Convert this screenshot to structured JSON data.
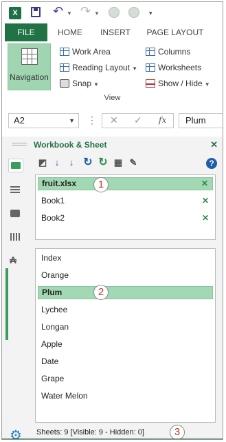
{
  "qat": {
    "app_icon": "excel-logo-icon",
    "app_letter": "X",
    "icons": [
      "save-icon",
      "undo-icon",
      "redo-icon",
      "circle-icon",
      "circle-icon",
      "customize-qat-icon"
    ]
  },
  "ribbon_tabs": [
    {
      "label": "FILE",
      "active_color": "#217346"
    },
    {
      "label": "HOME"
    },
    {
      "label": "INSERT"
    },
    {
      "label": "PAGE LAYOUT"
    }
  ],
  "ribbon": {
    "navigation_label": "Navigation",
    "work_area": "Work Area",
    "reading_layout": "Reading Layout",
    "snap": "Snap",
    "columns": "Columns",
    "worksheets": "Worksheets",
    "show_hide": "Show / Hide",
    "group_label": "View"
  },
  "formula_bar": {
    "name_box": "A2",
    "fx": "fx",
    "content": "Plum"
  },
  "pane": {
    "title": "Workbook & Sheet",
    "workbooks": [
      {
        "name": "fruit.xlsx",
        "selected": true
      },
      {
        "name": "Book1",
        "selected": false
      },
      {
        "name": "Book2",
        "selected": false
      }
    ],
    "sheets": [
      {
        "name": "Index",
        "selected": false
      },
      {
        "name": "Orange",
        "selected": false
      },
      {
        "name": "Plum",
        "selected": true
      },
      {
        "name": "Lychee",
        "selected": false
      },
      {
        "name": "Longan",
        "selected": false
      },
      {
        "name": "Apple",
        "selected": false
      },
      {
        "name": "Date",
        "selected": false
      },
      {
        "name": "Grape",
        "selected": false
      },
      {
        "name": "Water Melon",
        "selected": false
      }
    ],
    "status": "Sheets: 9  [Visible: 9 - Hidden: 0]",
    "callouts": [
      "1",
      "2",
      "3"
    ],
    "accent": "#217346",
    "selection_color": "#a2d8b3"
  }
}
